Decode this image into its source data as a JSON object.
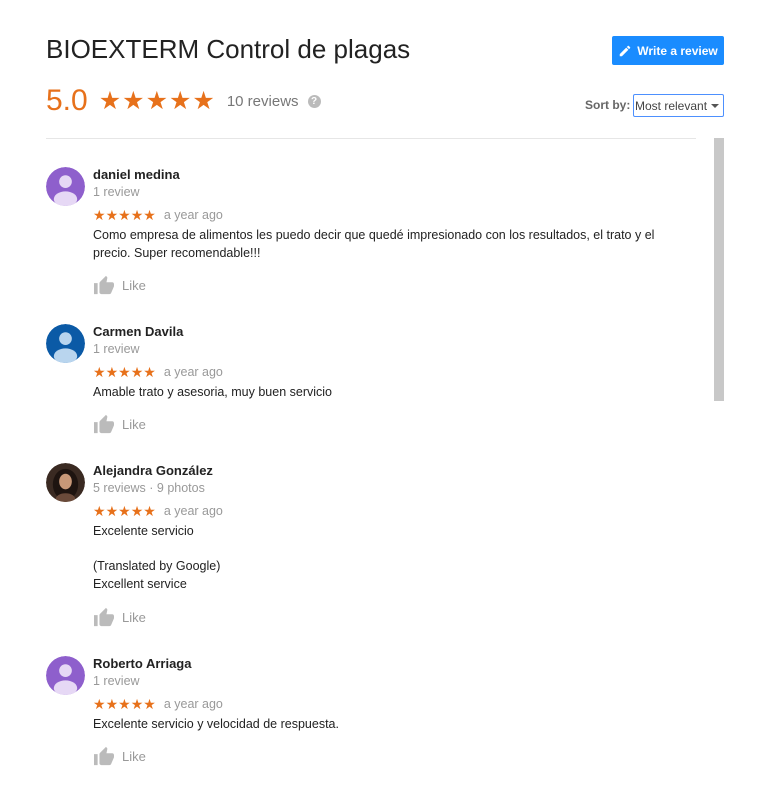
{
  "header": {
    "title": "BIOEXTERM Control de plagas",
    "write_review_label": "Write a review",
    "score": "5.0",
    "review_count": "10 reviews",
    "help_glyph": "?"
  },
  "sort": {
    "label": "Sort by:",
    "selected": "Most relevant"
  },
  "colors": {
    "accent": "#e7711b",
    "button": "#1a8cff"
  },
  "reviews": [
    {
      "author": "daniel medina",
      "meta": "1 review",
      "rating": 5,
      "age": "a year ago",
      "text": "Como empresa de alimentos les puedo decir que quedé impresionado con los resultados, el trato y el precio. Super recomendable!!!",
      "like_label": "Like",
      "avatar_color": "#8e5fcc"
    },
    {
      "author": "Carmen Davila",
      "meta": "1 review",
      "rating": 5,
      "age": "a year ago",
      "text": "Amable trato y asesoria, muy buen servicio",
      "like_label": "Like",
      "avatar_color": "#0b5aa6"
    },
    {
      "author": "Alejandra González",
      "meta": "5 reviews · 9 photos",
      "rating": 5,
      "age": "a year ago",
      "text": "Excelente servicio",
      "translation_note": "(Translated by Google)",
      "translated_text": "Excellent service",
      "like_label": "Like",
      "avatar_color": "#3a2a22"
    },
    {
      "author": "Roberto Arriaga",
      "meta": "1 review",
      "rating": 5,
      "age": "a year ago",
      "text": "Excelente servicio y velocidad de respuesta.",
      "like_label": "Like",
      "avatar_color": "#8e5fcc"
    }
  ]
}
